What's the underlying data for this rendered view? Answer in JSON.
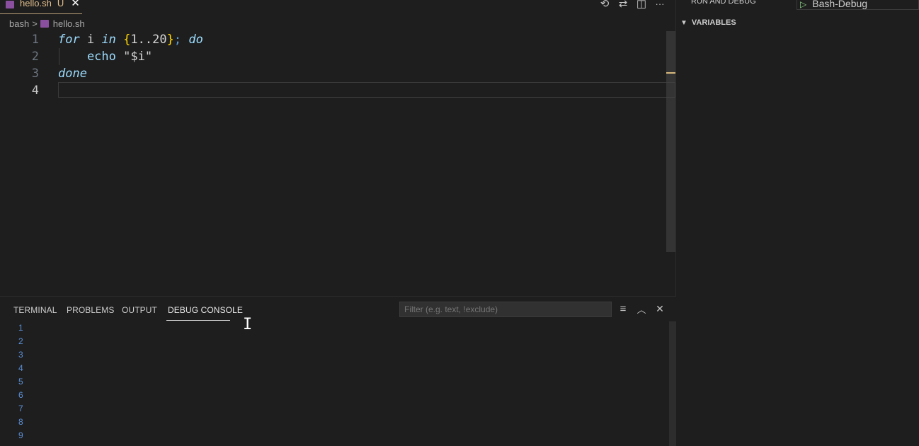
{
  "tab": {
    "file_name": "hello.sh",
    "status": "U",
    "close": "✕"
  },
  "tab_actions": {
    "timeline": "⟲",
    "compare": "⇄",
    "split": "◫",
    "more": "···"
  },
  "breadcrumb": {
    "folder": "bash",
    "separator": ">",
    "file": "hello.sh"
  },
  "code": {
    "line_numbers": [
      "1",
      "2",
      "3",
      "4"
    ],
    "line1": {
      "for": "for",
      "i": " i ",
      "in": "in",
      "open": " {",
      "range": "1..20",
      "close": "}",
      "semi": "; ",
      "do": "do"
    },
    "line2": {
      "echo": "    echo ",
      "str": "\"$i\""
    },
    "line3": {
      "done": "done"
    }
  },
  "panel": {
    "tabs": [
      "TERMINAL",
      "PROBLEMS",
      "OUTPUT",
      "DEBUG CONSOLE"
    ],
    "active_tab": "DEBUG CONSOLE",
    "filter_placeholder": "Filter (e.g. text, !exclude)",
    "actions": {
      "clear": "≡",
      "maximize": "︿",
      "close": "✕"
    },
    "output": [
      "1",
      "2",
      "3",
      "4",
      "5",
      "6",
      "7",
      "8",
      "9"
    ]
  },
  "debug": {
    "title": "RUN AND DEBUG",
    "config": "Bash-Debug",
    "variables_header": "VARIABLES"
  },
  "colors": {
    "accent": "#e2c08d",
    "keyword": "#569cd6",
    "bracket": "#ffd700",
    "string": "#ce9178",
    "console_text": "#5b8fd6",
    "play": "#89d185"
  }
}
